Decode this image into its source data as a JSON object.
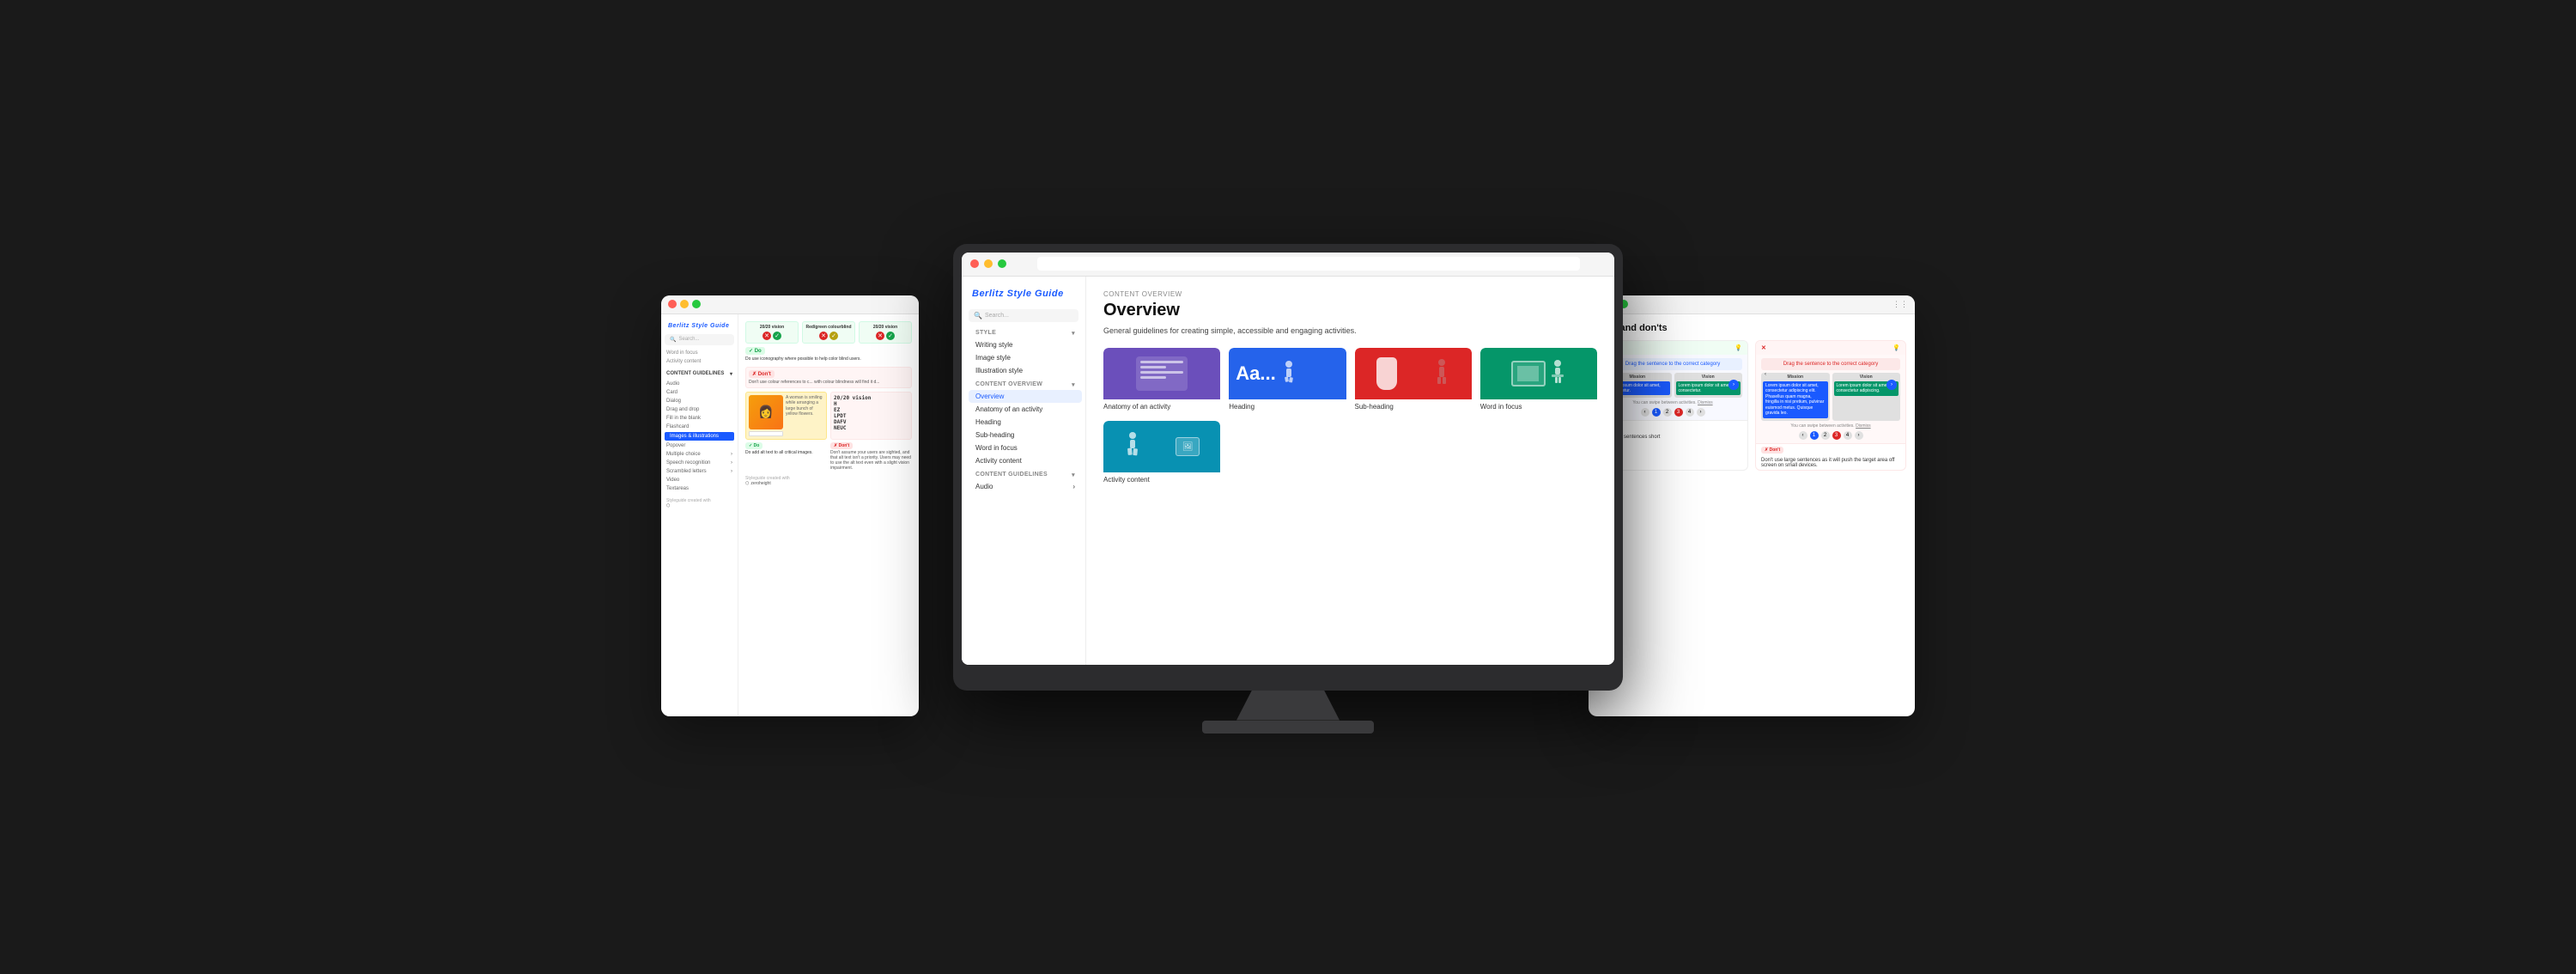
{
  "app": {
    "title": "Berlitz Style Guide"
  },
  "monitor": {
    "topbar_dots": [
      "red",
      "yellow",
      "green"
    ]
  },
  "browser": {
    "logo": "Berlitz",
    "search_placeholder": "Search...",
    "style_section": "STYLE",
    "style_items": [
      "Writing style",
      "Image style",
      "Illustration style"
    ],
    "content_overview_section": "CONTENT OVERVIEW",
    "content_overview_items": [
      "Overview",
      "Anatomy of an activity",
      "Heading",
      "Sub-heading",
      "Word in focus",
      "Activity content"
    ],
    "content_guidelines_section": "CONTENT GUIDELINES",
    "content_guidelines_items": [
      "Audio",
      "Card",
      "Dialog",
      "Drag and drop",
      "Fill in the blank",
      "Flashcard",
      "Images & illustrations",
      "Popover",
      "Multiple choice",
      "Speech recognition",
      "Scrambled letters",
      "Video",
      "Textareas"
    ],
    "active_item": "Images & illustrations",
    "footer_text": "Styleguide created with",
    "footer_brand": "zeroheight"
  },
  "main_content": {
    "section_label": "CONTENT OVERVIEW",
    "title": "Overview",
    "description": "General guidelines for creating simple, accessible and engaging activities.",
    "cards": [
      {
        "id": "anatomy",
        "label": "Anatomy of an activity",
        "color": "purple"
      },
      {
        "id": "heading",
        "label": "Heading",
        "color": "blue"
      },
      {
        "id": "subheading",
        "label": "Sub-heading",
        "color": "red"
      },
      {
        "id": "word-focus",
        "label": "Word in focus",
        "color": "green"
      }
    ],
    "cards_row2": [
      {
        "id": "activity-content",
        "label": "Activity content",
        "color": "teal"
      }
    ]
  },
  "left_window": {
    "title": "Berlitz Style Guide",
    "sections": {
      "style": "STYLE",
      "content_overview": "CONTENT OVERVIEW",
      "content_guidelines": "CONTENT GUIDELINES"
    },
    "active_section": "Images & illustrations",
    "items": {
      "word_in_focus": "Word in focus",
      "activity_content": "Activity content",
      "audio": "Audio",
      "card": "Card",
      "dialog": "Dialog",
      "drag_and_drop": "Drag and drop",
      "fill_in_blank": "Fill in the blank",
      "flashcard": "Flashcard",
      "images_illustrations": "Images & illustrations",
      "popover": "Popover",
      "multiple_choice": "Multiple choice",
      "speech_recognition": "Speech recognition",
      "scrambled_letters": "Scrambled letters",
      "video": "Video",
      "textareas": "Textareas"
    },
    "do_label": "✓ Do",
    "dont_label": "✗ Don't",
    "do_text_1": "Do use iconography where possible to help color blind users.",
    "dont_text_1": "Don't use colour references to c... with colour blindness will find it d...",
    "do_text_2": "Do add alt text to all critical images.",
    "dont_text_2": "Don't assume your users are sighted, and that alt text isn't a priority. Users may need to use the alt text even with a slight vision impairment."
  },
  "right_window": {
    "title": "Do's and don'ts",
    "do_label": "✓ Do",
    "dont_label": "✗ Don't",
    "card1": {
      "type": "do",
      "title": "Drag the sentence to the correct category",
      "column1": "Mission",
      "column2": "Vision",
      "item1": "Lorem ipsum dolor sit amet, consectetur.",
      "nav_hint": "You can swipe between activities. Dismiss"
    },
    "card2": {
      "type": "dont",
      "title": "Drag the sentence to the correct category",
      "column1": "Mission",
      "column2": "Vision",
      "item1": "Lorem ipsum dolor sit amet, consectetur adipiscing elit. Phasellus quam magna, fringilla in nisi pretium, pulvinar euismod metus. Quisque gravida leo.",
      "nav_hint": "You can swipe between activities. Dismiss"
    },
    "do_description": "Do keep sentences short",
    "dont_description": "Don't use large sentences as it will push the target area off screen on small devices."
  },
  "icons": {
    "search": "🔍",
    "chevron_down": "▾",
    "chevron_right": "›",
    "close": "✕",
    "check": "✓",
    "arrow_left": "‹",
    "arrow_right": "›",
    "lightbulb": "💡",
    "zeroheight": "⬡"
  },
  "colors": {
    "berlitz_blue": "#1a5aff",
    "do_green": "#16a34a",
    "dont_red": "#dc2626",
    "purple_card": "#7c4dbb",
    "blue_card": "#2563eb",
    "red_card": "#dc2626",
    "green_card": "#059669",
    "teal_card": "#0891b2"
  }
}
